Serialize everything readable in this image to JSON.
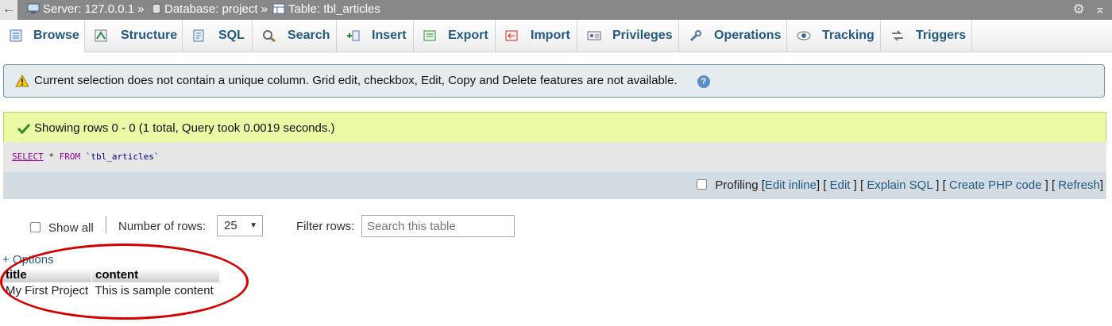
{
  "breadcrumb": {
    "back_glyph": "←",
    "server": "Server: 127.0.0.1",
    "database": "Database: project",
    "table": "Table: tbl_articles",
    "separator": "»"
  },
  "tabs": [
    {
      "label": "Browse",
      "icon": "browse-icon",
      "active": true
    },
    {
      "label": "Structure",
      "icon": "structure-icon",
      "active": false
    },
    {
      "label": "SQL",
      "icon": "sql-icon",
      "active": false
    },
    {
      "label": "Search",
      "icon": "search-icon",
      "active": false
    },
    {
      "label": "Insert",
      "icon": "insert-icon",
      "active": false
    },
    {
      "label": "Export",
      "icon": "export-icon",
      "active": false
    },
    {
      "label": "Import",
      "icon": "import-icon",
      "active": false
    },
    {
      "label": "Privileges",
      "icon": "privileges-icon",
      "active": false
    },
    {
      "label": "Operations",
      "icon": "wrench-icon",
      "active": false
    },
    {
      "label": "Tracking",
      "icon": "eye-icon",
      "active": false
    },
    {
      "label": "Triggers",
      "icon": "triggers-icon",
      "active": false
    }
  ],
  "notice": {
    "text": "Current selection does not contain a unique column. Grid edit, checkbox, Edit, Copy and Delete features are not available."
  },
  "success": {
    "text": "Showing rows 0 - 0 (1 total, Query took 0.0019 seconds.)"
  },
  "sql": {
    "select": "SELECT",
    "star": " * ",
    "from": "FROM",
    "table": " `tbl_articles`"
  },
  "tools": {
    "profiling": "Profiling",
    "edit_inline": "Edit inline",
    "edit": "Edit",
    "explain": "Explain SQL",
    "php": "Create PHP code",
    "refresh": "Refresh"
  },
  "navigation": {
    "show_all": "Show all",
    "num_rows_label": "Number of rows:",
    "num_rows_value": "25",
    "filter_label": "Filter rows:",
    "filter_placeholder": "Search this table"
  },
  "options_link": "+ Options",
  "result_table": {
    "columns": [
      "title",
      "content"
    ],
    "rows": [
      [
        "My First Project",
        "This is sample content"
      ]
    ]
  },
  "colors": {
    "annotation": "#d40000",
    "link": "#235a81",
    "success_bg": "#ebf8a4",
    "notice_bg": "#e4ecf0"
  }
}
